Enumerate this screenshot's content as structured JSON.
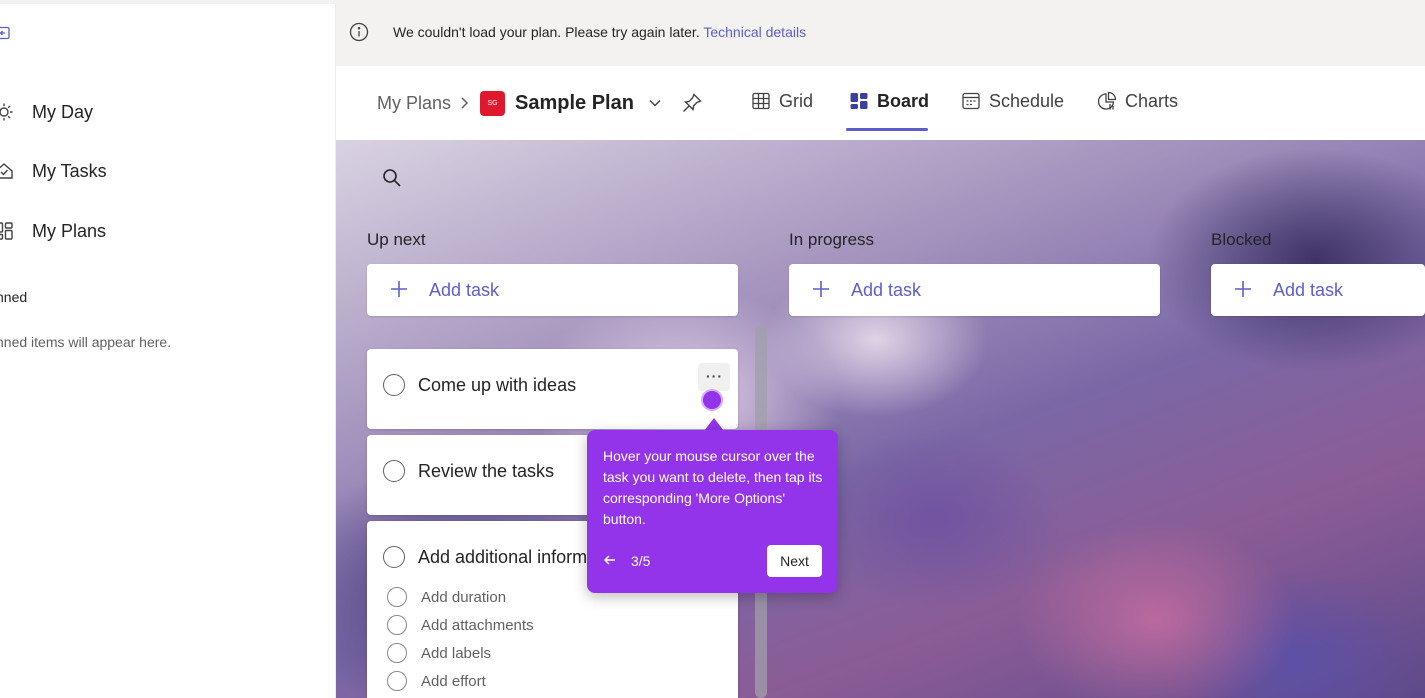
{
  "sidebar": {
    "nav": [
      {
        "label": "My Day",
        "icon": "sun-icon"
      },
      {
        "label": "My Tasks",
        "icon": "tasks-icon"
      },
      {
        "label": "My Plans",
        "icon": "plans-grid-icon"
      }
    ],
    "pinned_title": "nned",
    "pinned_empty": "nned items will appear here."
  },
  "banner": {
    "message": "We couldn't load your plan. Please try again later.",
    "link": "Technical details"
  },
  "header": {
    "breadcrumb": "My Plans",
    "plan_badge": "SG",
    "plan_title": "Sample Plan",
    "tabs": [
      {
        "label": "Grid",
        "icon": "grid-icon"
      },
      {
        "label": "Board",
        "icon": "board-icon",
        "active": true
      },
      {
        "label": "Schedule",
        "icon": "calendar-icon"
      },
      {
        "label": "Charts",
        "icon": "chart-icon"
      }
    ]
  },
  "columns": [
    {
      "title": "Up next",
      "add_label": "Add task"
    },
    {
      "title": "In progress",
      "add_label": "Add task"
    },
    {
      "title": "Blocked",
      "add_label": "Add task"
    }
  ],
  "tasks": [
    {
      "title": "Come up with ideas"
    },
    {
      "title": "Review the tasks"
    },
    {
      "title": "Add additional inform",
      "checklist": [
        "Add duration",
        "Add attachments",
        "Add labels",
        "Add effort"
      ]
    }
  ],
  "tooltip": {
    "text": "Hover your mouse cursor over the task you want to delete, then tap its corresponding 'More Options' button.",
    "step": "3/5",
    "next_label": "Next"
  },
  "colors": {
    "accent": "#5b5fc7",
    "tooltip": "#9333ea",
    "plan_badge": "#e0182d"
  }
}
